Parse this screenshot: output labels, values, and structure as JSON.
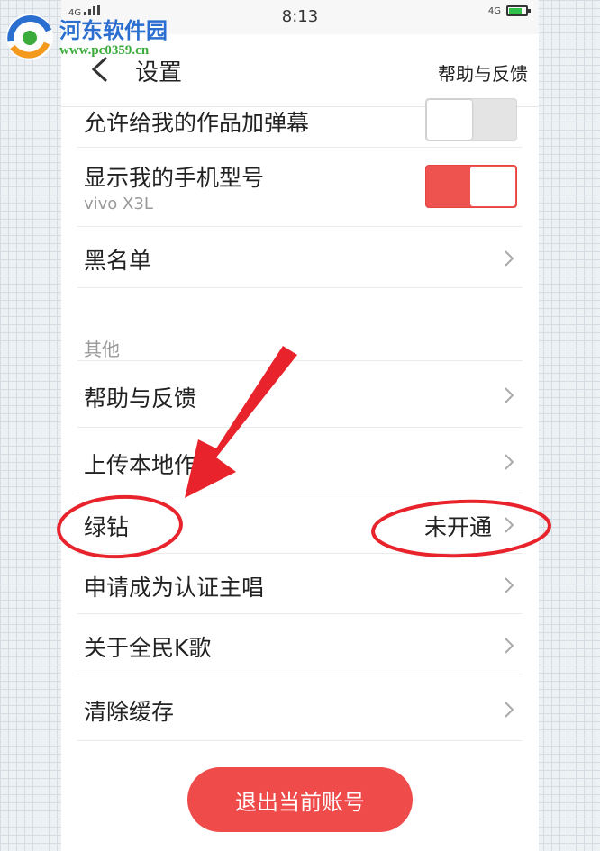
{
  "status_bar": {
    "time": "8:13",
    "network_left": "4G",
    "network_right": "4G"
  },
  "watermark": {
    "title": "河东软件园",
    "url": "www.pc0359.cn"
  },
  "navbar": {
    "back_icon": "chevron-left-icon",
    "title": "设置",
    "help_link": "帮助与反馈"
  },
  "settings": {
    "allow_danmaku": {
      "label": "允许给我的作品加弹幕",
      "enabled": false
    },
    "show_model": {
      "label": "显示我的手机型号",
      "sub": "vivo X3L",
      "enabled": true
    },
    "blacklist": {
      "label": "黑名单"
    }
  },
  "other_section": {
    "header": "其他",
    "items": [
      {
        "label": "帮助与反馈"
      },
      {
        "label": "上传本地作品"
      },
      {
        "label": "绿钻",
        "value": "未开通"
      },
      {
        "label": "申请成为认证主唱"
      },
      {
        "label": "关于全民K歌"
      },
      {
        "label": "清除缓存"
      }
    ]
  },
  "logout_button": "退出当前账号",
  "colors": {
    "accent": "#ef4b4b",
    "toggle_on": "#ef5350",
    "annotation": "#e8232b",
    "watermark_blue": "#2a6fcf",
    "watermark_green": "#3bab3b"
  }
}
